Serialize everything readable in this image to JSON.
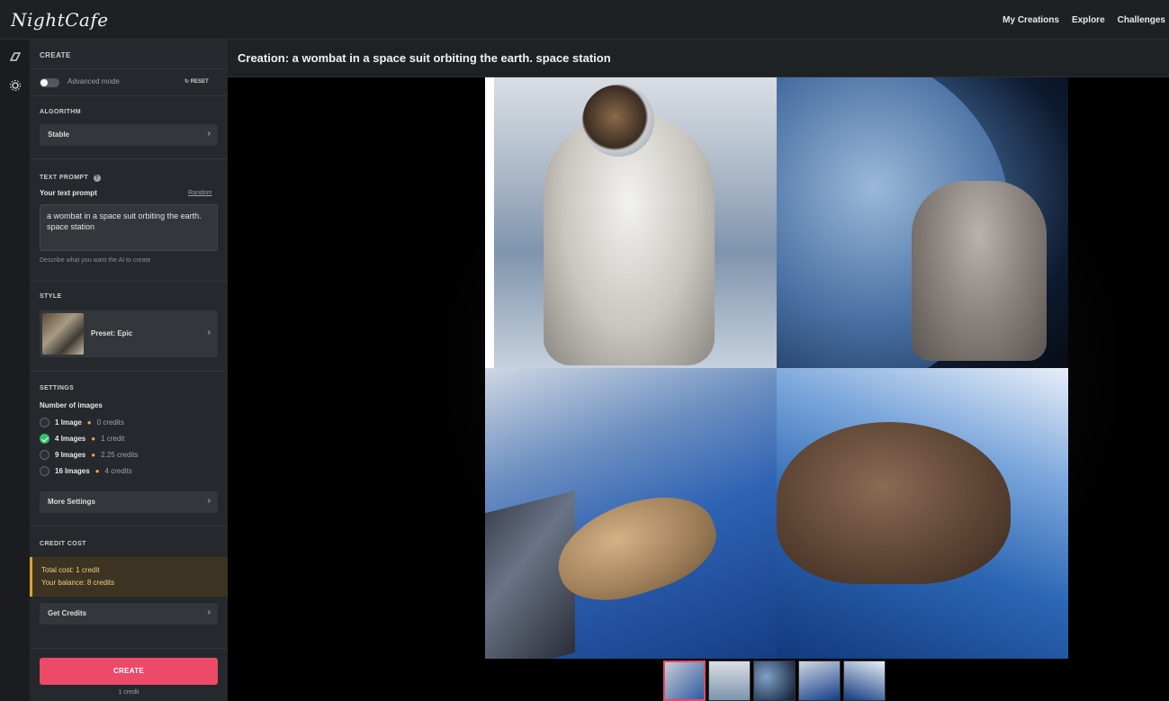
{
  "app": {
    "logo": "NightCafe"
  },
  "topnav": {
    "items": [
      "My Creations",
      "Explore",
      "Challenges"
    ]
  },
  "rail": {
    "icons": [
      "create-icon",
      "settings-icon"
    ]
  },
  "sidebar": {
    "header": "CREATE",
    "advanced_mode_label": "Advanced mode",
    "advanced_mode_on": false,
    "reset_label": "RESET",
    "algorithm": {
      "title": "ALGORITHM",
      "value": "Stable"
    },
    "text_prompt": {
      "title": "TEXT PROMPT",
      "label": "Your text prompt",
      "random_link": "Random",
      "value": "a wombat in a space suit orbiting the earth. space station",
      "helper": "Describe what you want the AI to create"
    },
    "style": {
      "title": "STYLE",
      "value": "Preset: Epic"
    },
    "settings": {
      "title": "SETTINGS",
      "label": "Number of images",
      "options": [
        {
          "label": "1 Image",
          "credits": "0 credits",
          "selected": false
        },
        {
          "label": "4 Images",
          "credits": "1 credit",
          "selected": true
        },
        {
          "label": "9 Images",
          "credits": "2.25 credits",
          "selected": false
        },
        {
          "label": "16 Images",
          "credits": "4 credits",
          "selected": false
        }
      ],
      "more_settings": "More Settings"
    },
    "credit_cost": {
      "title": "CREDIT COST",
      "total": "Total cost: 1 credit",
      "balance": "Your balance: 8 credits",
      "get_credits": "Get Credits"
    },
    "create_button": "CREATE",
    "create_sub": "1 credit"
  },
  "main": {
    "title": "Creation: a wombat in a space suit orbiting the earth. space station"
  },
  "colors": {
    "accent": "#ec4a68",
    "check": "#32c06a",
    "credit_gold": "#d8a339"
  }
}
